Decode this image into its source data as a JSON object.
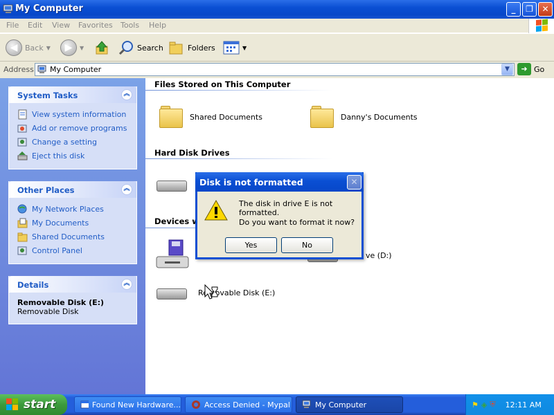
{
  "window": {
    "title": "My Computer"
  },
  "menu": [
    "File",
    "Edit",
    "View",
    "Favorites",
    "Tools",
    "Help"
  ],
  "toolbar": {
    "back": "Back",
    "search": "Search",
    "folders": "Folders"
  },
  "address": {
    "label": "Address",
    "value": "My Computer",
    "go": "Go"
  },
  "left": {
    "system_tasks": {
      "title": "System Tasks",
      "items": [
        "View system information",
        "Add or remove programs",
        "Change a setting",
        "Eject this disk"
      ]
    },
    "other_places": {
      "title": "Other Places",
      "items": [
        "My Network Places",
        "My Documents",
        "Shared Documents",
        "Control Panel"
      ]
    },
    "details": {
      "title": "Details",
      "name": "Removable Disk (E:)",
      "type": "Removable Disk"
    }
  },
  "main": {
    "files_section": "Files Stored on This Computer",
    "shared_docs": "Shared Documents",
    "danny_docs": "Danny's Documents",
    "hdd_section": "Hard Disk Drives",
    "devices_section": "Devices wi",
    "dvd_label_partial": "ve (D:)",
    "removable_label": "Removable Disk (E:)"
  },
  "dialog": {
    "title": "Disk is not formatted",
    "line1": "The disk in drive E is not formatted.",
    "line2": "Do you want to format it now?",
    "yes": "Yes",
    "no": "No"
  },
  "taskbar": {
    "start": "start",
    "tasks": [
      "Found New Hardware...",
      "Access Denied - Mypal",
      "My Computer"
    ],
    "clock": "12:11 AM"
  },
  "colors": {
    "xp_blue": "#0a4fd3",
    "link": "#215dc6",
    "start_green": "#3c9a3c"
  }
}
